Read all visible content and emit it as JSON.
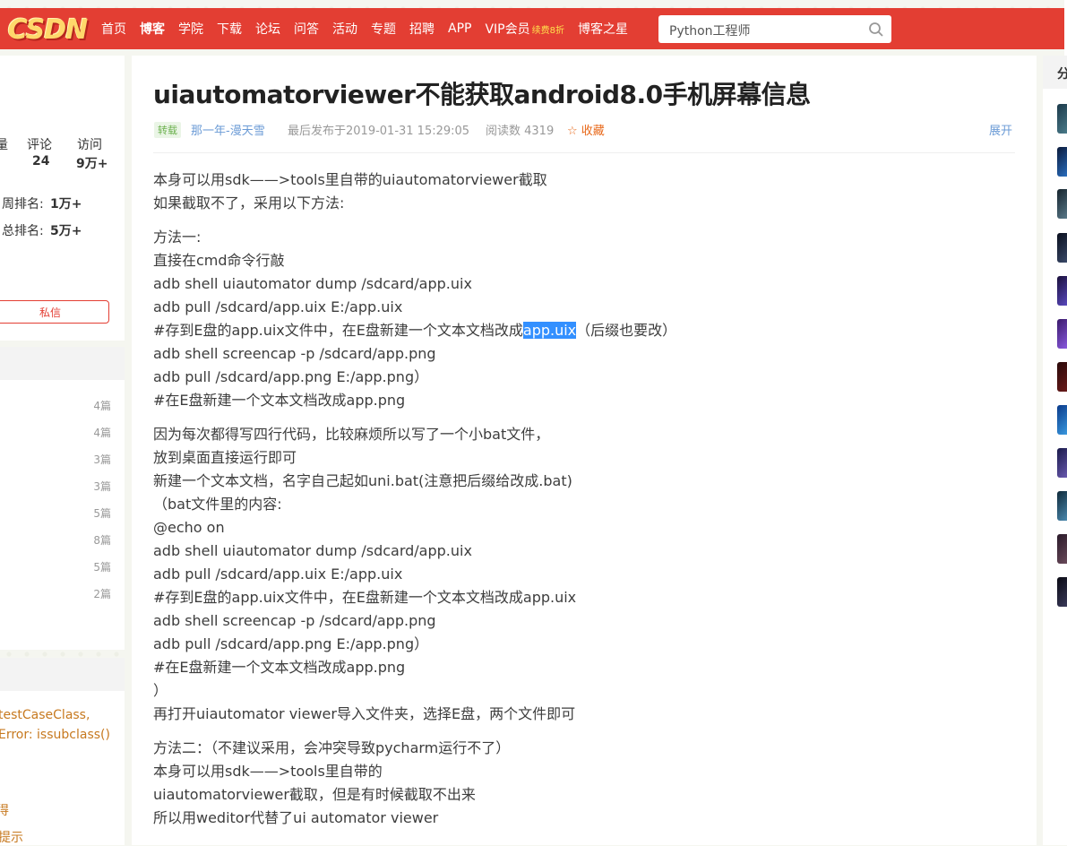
{
  "nav": {
    "logo": "CSDN",
    "items": [
      "首页",
      "博客",
      "学院",
      "下载",
      "论坛",
      "问答",
      "活动",
      "专题",
      "招聘",
      "APP",
      "VIP会员"
    ],
    "vip_badge": "续费8折",
    "star": "博客之星",
    "search_value": "Python工程师"
  },
  "left": {
    "stat_labels": [
      "评论",
      "访问"
    ],
    "stat_values": [
      "24",
      "9万+"
    ],
    "week_rank_label": "周排名:",
    "week_rank_value": "1万+",
    "total_rank_label": "总排名:",
    "total_rank_value": "5万+",
    "message_button": "私信",
    "category_counts": [
      "4篇",
      "4篇",
      "3篇",
      "3篇",
      "5篇",
      "8篇",
      "5篇",
      "2篇"
    ],
    "recent_1": "testCaseClass,",
    "recent_2": "Error: issubclass()"
  },
  "article": {
    "title": "uiautomatorviewer不能获取android8.0手机屏幕信息",
    "tag": "转载",
    "author": "那一年-漫天雪",
    "published": "最后发布于2019-01-31 15:29:05",
    "reads": "阅读数 4319",
    "favorite": "收藏",
    "expand": "展开",
    "p1": [
      "本身可以用sdk——>tools里自带的uiautomatorviewer截取",
      "如果截取不了，采用以下方法:"
    ],
    "p2": [
      "方法一:",
      "直接在cmd命令行敲",
      "adb shell uiautomator dump /sdcard/app.uix",
      "adb pull /sdcard/app.uix E:/app.uix"
    ],
    "p2_hl_pre": "#存到E盘的app.uix文件中，在E盘新建一个文本文档改成",
    "p2_hl": "app.uix",
    "p2_hl_post": "（后缀也要改）",
    "p2b": [
      "adb shell screencap -p /sdcard/app.png",
      "adb pull /sdcard/app.png E:/app.png）",
      "#在E盘新建一个文本文档改成app.png"
    ],
    "p3": [
      "因为每次都得写四行代码，比较麻烦所以写了一个小bat文件，",
      "放到桌面直接运行即可",
      "新建一个文本文档，名字自己起如uni.bat(注意把后缀给改成.bat)",
      "（bat文件里的内容:",
      "@echo on",
      "adb shell uiautomator dump /sdcard/app.uix",
      "adb pull /sdcard/app.uix E:/app.uix",
      "#存到E盘的app.uix文件中，在E盘新建一个文本文档改成app.uix",
      "adb shell screencap -p /sdcard/app.png",
      "adb pull /sdcard/app.png E:/app.png）",
      "#在E盘新建一个文本文档改成app.png",
      "）",
      "再打开uiautomator viewer导入文件夹，选择E盘，两个文件即可"
    ],
    "p4": [
      "方法二：（不建议采用，会冲突导致pycharm运行不了）",
      "本身可以用sdk——>tools里自带的",
      "uiautomatorviewer截取，但是有时候截取不出来",
      "所以用weditor代替了ui automator viewer"
    ]
  },
  "right": {
    "head": "分"
  },
  "colors": {
    "brand": "#e33e33",
    "link": "#6b9bd6",
    "accent": "#e8691b"
  }
}
